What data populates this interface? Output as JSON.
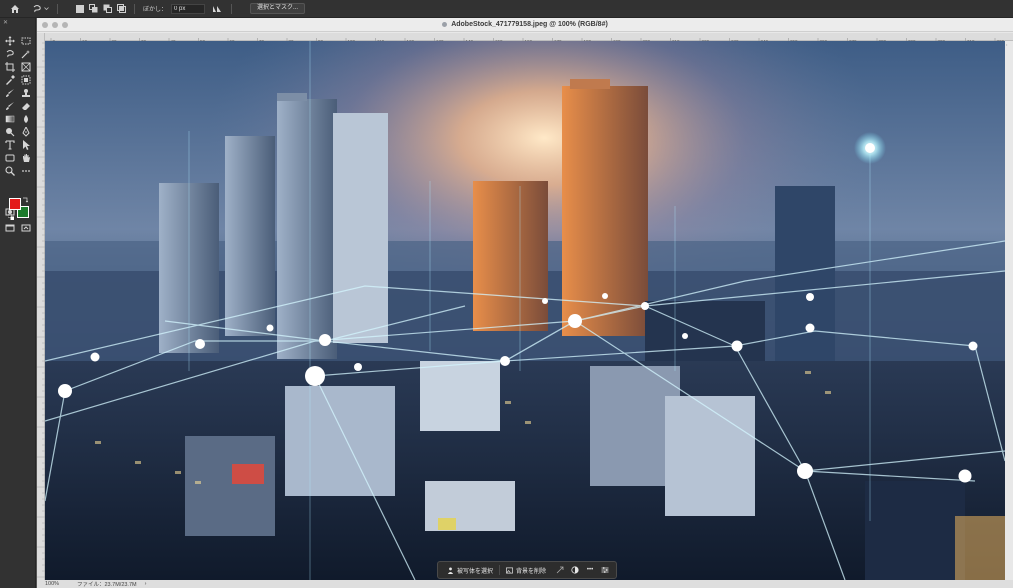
{
  "options_bar": {
    "home_icon": "home-icon",
    "tool_preset_icon": "lasso-icon",
    "selection_modes": [
      "new-selection-icon",
      "add-to-selection-icon",
      "subtract-from-selection-icon",
      "intersect-selection-icon"
    ],
    "feather_label": "ぼかし：",
    "feather_value": "0 px",
    "antialias_icon": "antialias-icon",
    "select_and_mask_label": "選択とマスク..."
  },
  "document": {
    "title": "AdobeStock_471779158.jpeg @ 100% (RGB/8#)",
    "ruler_top_ticks": [
      "0",
      "10",
      "20",
      "30",
      "40",
      "50",
      "60",
      "70",
      "80",
      "90",
      "100",
      "110",
      "120",
      "130",
      "140",
      "150",
      "160",
      "170",
      "180",
      "190",
      "200",
      "210",
      "220",
      "230",
      "240",
      "250",
      "260",
      "270",
      "280",
      "290",
      "300",
      "310",
      "320"
    ],
    "canvas_description_icon": "cityscape-network-image"
  },
  "statusbar": {
    "zoom": "100%",
    "file_info": "ファイル：23.7M/23.7M",
    "arrow": "›"
  },
  "contextual_taskbar": {
    "select_subject_label": "被写体を選択",
    "remove_background_label": "背景を削除",
    "more_label": "•••"
  },
  "colors": {
    "foreground": "#e31b1b",
    "background": "#1c7a2c",
    "ui_dark": "#323232"
  }
}
